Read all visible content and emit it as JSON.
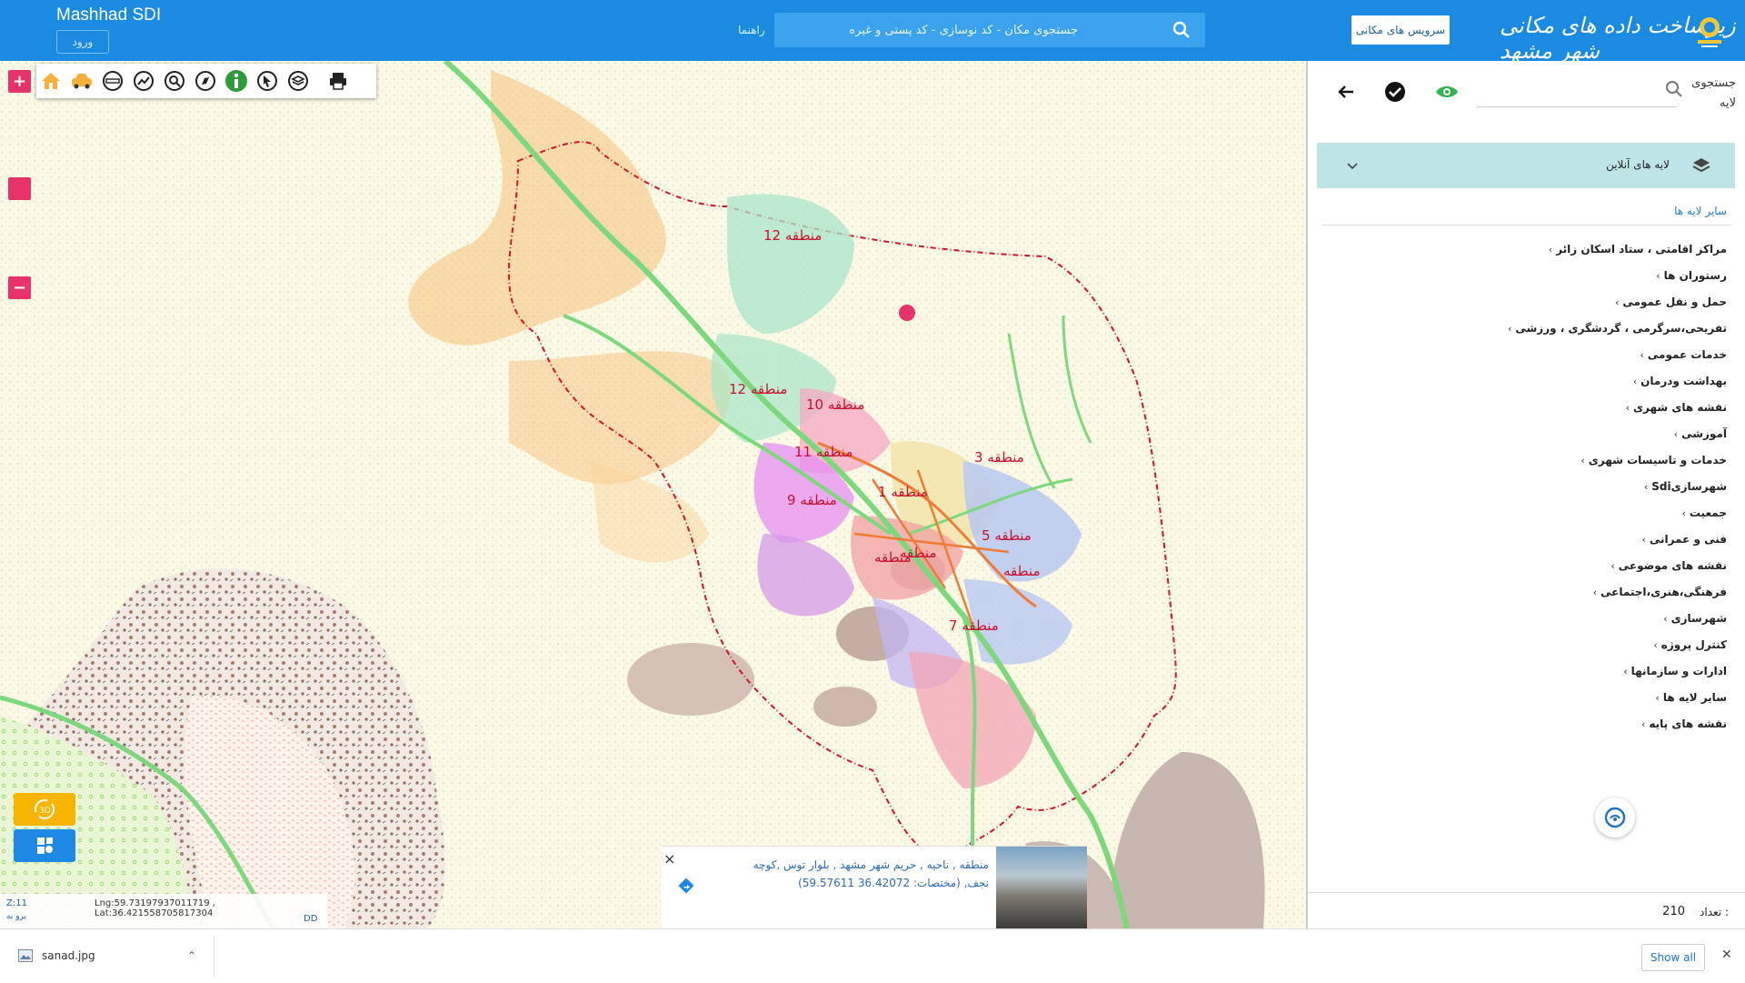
{
  "header": {
    "brand": "Mashhad SDI",
    "login_label": "ورود",
    "guide_label": "راهنما",
    "search_placeholder": "جستجوی مکان - کد نوسازی - کد پستی و غیره",
    "services_label": "سرویس های مکانی",
    "logo_title": "زیرساخت داده های مکانی شهر مشهد",
    "colors": {
      "bar": "#1a8be0",
      "search": "#3ba2ee"
    }
  },
  "toolbar": {
    "icons": [
      "home-icon",
      "taxi-icon",
      "measure-icon",
      "chart-icon",
      "search-zoom-icon",
      "compass-icon",
      "info-icon",
      "pointer-icon",
      "layers-icon",
      "print-icon"
    ]
  },
  "map": {
    "zones": [
      "منطقه 12",
      "منطقه 12",
      "منطقه 10",
      "منطقه 11",
      "منطقه 3",
      "منطقه 1",
      "منطقه 9",
      "منطقه 5",
      "منطقه",
      "منطقه 7",
      "منطقه",
      "منطقه"
    ],
    "zoom_in": "+",
    "zoom_out": "−"
  },
  "coords": {
    "zoom": "Z:11",
    "lnglat": "Lng:59.73197937011719 , Lat:36.421558705817304",
    "unit": "برو به",
    "format": "DD"
  },
  "popup": {
    "close": "×",
    "line1": "منطقه , ناحیه , حریم شهر مشهد , بلوار توس ,کوچه",
    "line2": "نجف, (مختصات: 36.42072 59.57611)"
  },
  "sidebar": {
    "search_label": "جستجوی لایه",
    "online_layers_label": "لایه های آنلاین",
    "other_layers_label": "سایر لایه ها",
    "categories": [
      "مراکز اقامتی ، ستاد اسکان زائر",
      "رستوران ها",
      "حمل و نقل عمومی",
      "تفریحی،سرگرمی ، گردشگری ، ورزشی",
      "خدمات عمومی",
      "بهداشت ودرمان",
      "نقشه های شهری",
      "آموزشی",
      "خدمات و تاسیسات شهری",
      "شهرسازیSdi",
      "جمعیت",
      "فنی و عمرانی",
      "نقشه های موضوعی",
      "فرهنگی،هنری،اجتماعی",
      "شهرسازی",
      "کنترل پروژه",
      "ادارات و سازمانها",
      "سایر لایه ها",
      "نقشه های پایه"
    ],
    "count_label": "تعداد :",
    "count_value": "210"
  },
  "download_bar": {
    "file_name": "sanad.jpg",
    "show_all": "Show all",
    "close": "✕"
  }
}
